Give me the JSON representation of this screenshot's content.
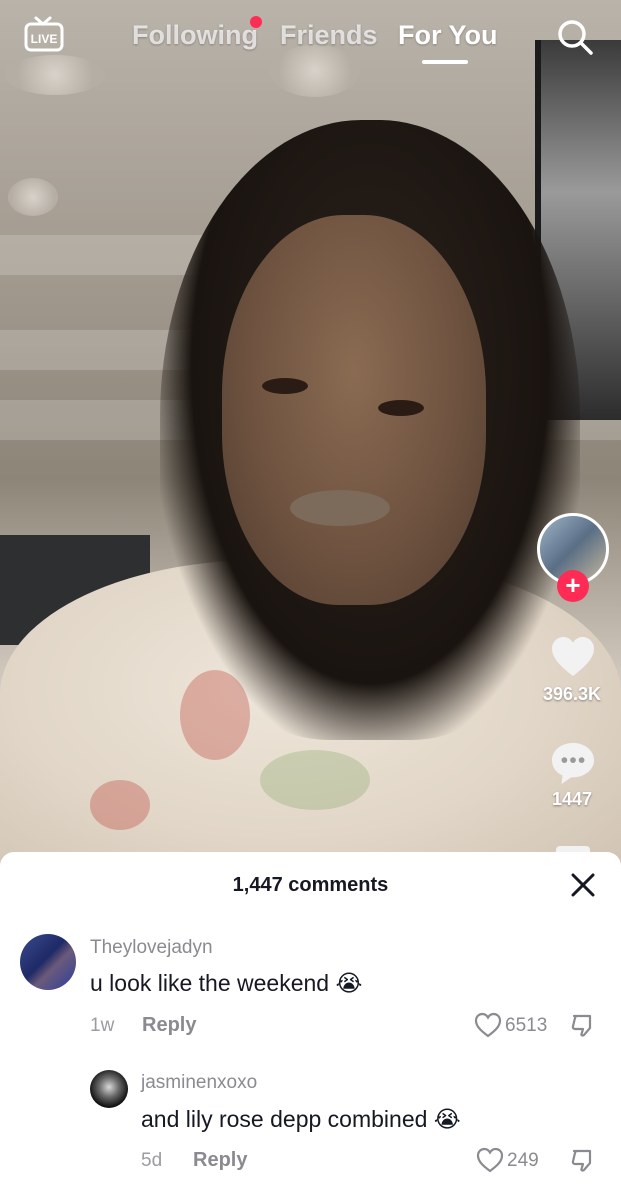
{
  "nav": {
    "live_label": "LIVE",
    "tabs": [
      {
        "label": "Following",
        "active": false,
        "has_notification": true
      },
      {
        "label": "Friends",
        "active": false
      },
      {
        "label": "For You",
        "active": true
      }
    ],
    "search_icon": "search-icon"
  },
  "rail": {
    "follow_icon": "plus-icon",
    "like_count": "396.3K",
    "comment_count": "1447"
  },
  "comments": {
    "title": "1,447 comments",
    "close_icon": "close-icon",
    "items": [
      {
        "username": "Theylovejadyn",
        "text": "u look like the weekend",
        "emoji": "😭",
        "age": "1w",
        "reply_label": "Reply",
        "likes": "6513"
      },
      {
        "username": "jasminenxoxo",
        "text": "and lily rose depp combined",
        "emoji": "😭",
        "age": "5d",
        "reply_label": "Reply",
        "likes": "249"
      }
    ]
  },
  "colors": {
    "accent": "#fe2c55",
    "sheet_bg": "#ffffff",
    "muted_text": "#8a8b91"
  }
}
